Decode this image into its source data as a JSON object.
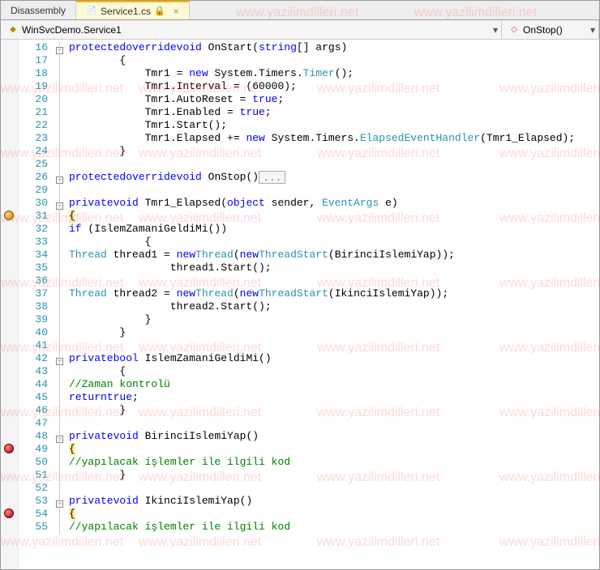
{
  "tabs": {
    "inactive": "Disassembly",
    "active": "Service1.cs"
  },
  "nav": {
    "class": "WinSvcDemo.Service1",
    "method": "OnStop()"
  },
  "watermark": "www.yazilimdilleri.net",
  "lines": [
    {
      "n": 16,
      "fold": "-",
      "txt": [
        [
          "        ",
          ""
        ],
        [
          "protected",
          "kw"
        ],
        [
          " ",
          ""
        ],
        [
          "override",
          "kw"
        ],
        [
          " ",
          ""
        ],
        [
          "void",
          "kw"
        ],
        [
          " OnStart(",
          ""
        ],
        [
          "string",
          "kw"
        ],
        [
          "[] args)",
          ""
        ]
      ]
    },
    {
      "n": 17,
      "txt": [
        [
          "        {",
          ""
        ]
      ]
    },
    {
      "n": 18,
      "txt": [
        [
          "            Tmr1 = ",
          ""
        ],
        [
          "new",
          "kw"
        ],
        [
          " System.Timers.",
          ""
        ],
        [
          "Timer",
          "type"
        ],
        [
          "();",
          ""
        ]
      ]
    },
    {
      "n": 19,
      "txt": [
        [
          "            Tmr1.Interval = (60000);",
          ""
        ]
      ]
    },
    {
      "n": 20,
      "txt": [
        [
          "            Tmr1.AutoReset = ",
          ""
        ],
        [
          "true",
          "kw"
        ],
        [
          ";",
          ""
        ]
      ]
    },
    {
      "n": 21,
      "txt": [
        [
          "            Tmr1.Enabled = ",
          ""
        ],
        [
          "true",
          "kw"
        ],
        [
          ";",
          ""
        ]
      ]
    },
    {
      "n": 22,
      "txt": [
        [
          "            Tmr1.Start();",
          ""
        ]
      ]
    },
    {
      "n": 23,
      "txt": [
        [
          "            Tmr1.Elapsed += ",
          ""
        ],
        [
          "new",
          "kw"
        ],
        [
          " System.Timers.",
          ""
        ],
        [
          "ElapsedEventHandler",
          "type"
        ],
        [
          "(Tmr1_Elapsed);",
          ""
        ]
      ]
    },
    {
      "n": 24,
      "txt": [
        [
          "        }",
          ""
        ]
      ]
    },
    {
      "n": 25,
      "txt": [
        [
          "",
          ""
        ]
      ]
    },
    {
      "n": 26,
      "fold": "+",
      "txt": [
        [
          "        ",
          ""
        ],
        [
          "protected",
          "kw"
        ],
        [
          " ",
          ""
        ],
        [
          "override",
          "kw"
        ],
        [
          " ",
          ""
        ],
        [
          "void",
          "kw"
        ],
        [
          " OnStop()",
          ""
        ]
      ],
      "collapsed": "..."
    },
    {
      "n": 29,
      "txt": [
        [
          "",
          ""
        ]
      ]
    },
    {
      "n": 30,
      "fold": "-",
      "txt": [
        [
          "        ",
          ""
        ],
        [
          "private",
          "kw"
        ],
        [
          " ",
          ""
        ],
        [
          "void",
          "kw"
        ],
        [
          " Tmr1_Elapsed(",
          ""
        ],
        [
          "object",
          "kw"
        ],
        [
          " sender, ",
          ""
        ],
        [
          "EventArgs",
          "type"
        ],
        [
          " e)",
          ""
        ]
      ]
    },
    {
      "n": 31,
      "bp": "yellow",
      "txt": [
        [
          "        ",
          ""
        ]
      ],
      "yellow": "{"
    },
    {
      "n": 32,
      "txt": [
        [
          "            ",
          ""
        ],
        [
          "if",
          "kw"
        ],
        [
          " (IslemZamaniGeldiMi())",
          ""
        ]
      ]
    },
    {
      "n": 33,
      "txt": [
        [
          "            {",
          ""
        ]
      ]
    },
    {
      "n": 34,
      "txt": [
        [
          "                ",
          ""
        ],
        [
          "Thread",
          "type"
        ],
        [
          " thread1 = ",
          ""
        ],
        [
          "new",
          "kw"
        ],
        [
          " ",
          ""
        ],
        [
          "Thread",
          "type"
        ],
        [
          "(",
          ""
        ],
        [
          "new",
          "kw"
        ],
        [
          " ",
          ""
        ],
        [
          "ThreadStart",
          "type"
        ],
        [
          "(BirinciIslemiYap));",
          ""
        ]
      ]
    },
    {
      "n": 35,
      "txt": [
        [
          "                thread1.Start();",
          ""
        ]
      ]
    },
    {
      "n": 36,
      "txt": [
        [
          "",
          ""
        ]
      ]
    },
    {
      "n": 37,
      "txt": [
        [
          "                ",
          ""
        ],
        [
          "Thread",
          "type"
        ],
        [
          " thread2 = ",
          ""
        ],
        [
          "new",
          "kw"
        ],
        [
          " ",
          ""
        ],
        [
          "Thread",
          "type"
        ],
        [
          "(",
          ""
        ],
        [
          "new",
          "kw"
        ],
        [
          " ",
          ""
        ],
        [
          "ThreadStart",
          "type"
        ],
        [
          "(IkinciIslemiYap));",
          ""
        ]
      ]
    },
    {
      "n": 38,
      "txt": [
        [
          "                thread2.Start();",
          ""
        ]
      ]
    },
    {
      "n": 39,
      "txt": [
        [
          "            }",
          ""
        ]
      ]
    },
    {
      "n": 40,
      "txt": [
        [
          "        }",
          ""
        ]
      ]
    },
    {
      "n": 41,
      "txt": [
        [
          "",
          ""
        ]
      ]
    },
    {
      "n": 42,
      "fold": "-",
      "txt": [
        [
          "        ",
          ""
        ],
        [
          "private",
          "kw"
        ],
        [
          " ",
          ""
        ],
        [
          "bool",
          "kw"
        ],
        [
          " IslemZamaniGeldiMi()",
          ""
        ]
      ]
    },
    {
      "n": 43,
      "txt": [
        [
          "        {",
          ""
        ]
      ]
    },
    {
      "n": 44,
      "txt": [
        [
          "            ",
          ""
        ],
        [
          "//Zaman kontrolü",
          "cmt"
        ]
      ]
    },
    {
      "n": 45,
      "txt": [
        [
          "            ",
          ""
        ],
        [
          "return",
          "kw"
        ],
        [
          " ",
          ""
        ],
        [
          "true",
          "kw"
        ],
        [
          ";",
          ""
        ]
      ]
    },
    {
      "n": 46,
      "txt": [
        [
          "        }",
          ""
        ]
      ]
    },
    {
      "n": 47,
      "txt": [
        [
          "",
          ""
        ]
      ]
    },
    {
      "n": 48,
      "fold": "-",
      "txt": [
        [
          "        ",
          ""
        ],
        [
          "private",
          "kw"
        ],
        [
          " ",
          ""
        ],
        [
          "void",
          "kw"
        ],
        [
          " BirinciIslemiYap()",
          ""
        ]
      ]
    },
    {
      "n": 49,
      "bp": "red",
      "txt": [
        [
          "        ",
          ""
        ]
      ],
      "yellow": "{"
    },
    {
      "n": 50,
      "txt": [
        [
          "            ",
          ""
        ],
        [
          "//yapılacak işlemler ile ilgili kod",
          "cmt"
        ]
      ]
    },
    {
      "n": 51,
      "txt": [
        [
          "        }",
          ""
        ]
      ]
    },
    {
      "n": 52,
      "txt": [
        [
          "",
          ""
        ]
      ]
    },
    {
      "n": 53,
      "fold": "-",
      "txt": [
        [
          "        ",
          ""
        ],
        [
          "private",
          "kw"
        ],
        [
          " ",
          ""
        ],
        [
          "void",
          "kw"
        ],
        [
          " IkinciIslemiYap()",
          ""
        ]
      ]
    },
    {
      "n": 54,
      "bp": "red",
      "txt": [
        [
          "        ",
          ""
        ]
      ],
      "yellow": "{"
    },
    {
      "n": 55,
      "txt": [
        [
          "            ",
          ""
        ],
        [
          "//yapılacak işlemler ile ilgili kod",
          "cmt"
        ]
      ]
    }
  ]
}
